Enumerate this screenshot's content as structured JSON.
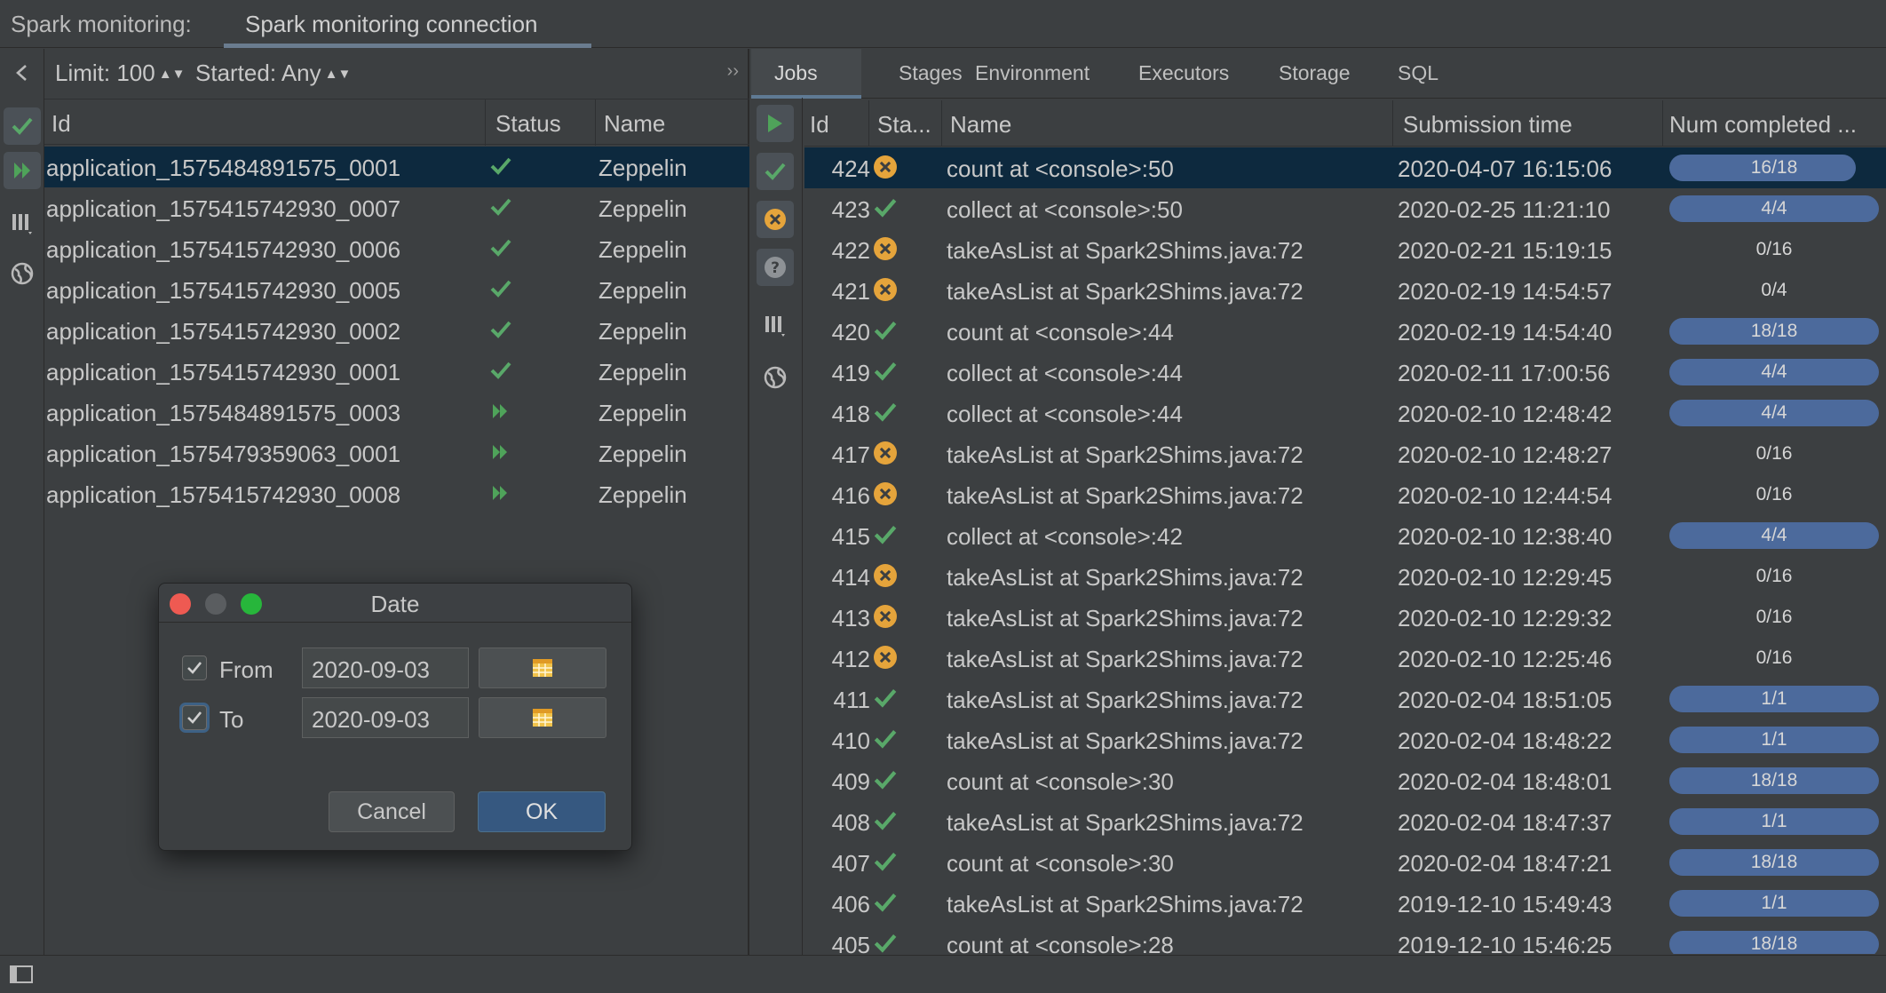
{
  "titlebar": {
    "label": "Spark monitoring:",
    "tab": "Spark monitoring connection"
  },
  "app_toolbar": {
    "limit": "Limit: 100",
    "started": "Started: Any",
    "expand": "››"
  },
  "app_table": {
    "headers": {
      "id": "Id",
      "status": "Status",
      "name": "Name"
    },
    "rows": [
      {
        "id": "application_1575484891575_0001",
        "status": "completed",
        "name": "Zeppelin"
      },
      {
        "id": "application_1575415742930_0007",
        "status": "completed",
        "name": "Zeppelin"
      },
      {
        "id": "application_1575415742930_0006",
        "status": "completed",
        "name": "Zeppelin"
      },
      {
        "id": "application_1575415742930_0005",
        "status": "completed",
        "name": "Zeppelin"
      },
      {
        "id": "application_1575415742930_0002",
        "status": "completed",
        "name": "Zeppelin"
      },
      {
        "id": "application_1575415742930_0001",
        "status": "completed",
        "name": "Zeppelin"
      },
      {
        "id": "application_1575484891575_0003",
        "status": "running",
        "name": "Zeppelin"
      },
      {
        "id": "application_1575479359063_0001",
        "status": "running",
        "name": "Zeppelin"
      },
      {
        "id": "application_1575415742930_0008",
        "status": "running",
        "name": "Zeppelin"
      }
    ]
  },
  "tabs": [
    "Jobs",
    "Stages",
    "Environment",
    "Executors",
    "Storage",
    "SQL"
  ],
  "jobs_table": {
    "headers": {
      "id": "Id",
      "status": "Sta...",
      "name": "Name",
      "time": "Submission time",
      "num": "Num completed ..."
    },
    "rows": [
      {
        "id": "424",
        "status": "failed",
        "name": "count at <console>:50",
        "time": "2020-04-07 16:15:06",
        "progress": "16/18",
        "fraction": 0.89
      },
      {
        "id": "423",
        "status": "succeeded",
        "name": "collect at <console>:50",
        "time": "2020-02-25 11:21:10",
        "progress": "4/4",
        "fraction": 1.0
      },
      {
        "id": "422",
        "status": "failed",
        "name": "takeAsList at Spark2Shims.java:72",
        "time": "2020-02-21 15:19:15",
        "progress": "0/16",
        "fraction": 0
      },
      {
        "id": "421",
        "status": "failed",
        "name": "takeAsList at Spark2Shims.java:72",
        "time": "2020-02-19 14:54:57",
        "progress": "0/4",
        "fraction": 0
      },
      {
        "id": "420",
        "status": "succeeded",
        "name": "count at <console>:44",
        "time": "2020-02-19 14:54:40",
        "progress": "18/18",
        "fraction": 1.0
      },
      {
        "id": "419",
        "status": "succeeded",
        "name": "collect at <console>:44",
        "time": "2020-02-11 17:00:56",
        "progress": "4/4",
        "fraction": 1.0
      },
      {
        "id": "418",
        "status": "succeeded",
        "name": "collect at <console>:44",
        "time": "2020-02-10 12:48:42",
        "progress": "4/4",
        "fraction": 1.0
      },
      {
        "id": "417",
        "status": "failed",
        "name": "takeAsList at Spark2Shims.java:72",
        "time": "2020-02-10 12:48:27",
        "progress": "0/16",
        "fraction": 0
      },
      {
        "id": "416",
        "status": "failed",
        "name": "takeAsList at Spark2Shims.java:72",
        "time": "2020-02-10 12:44:54",
        "progress": "0/16",
        "fraction": 0
      },
      {
        "id": "415",
        "status": "succeeded",
        "name": "collect at <console>:42",
        "time": "2020-02-10 12:38:40",
        "progress": "4/4",
        "fraction": 1.0
      },
      {
        "id": "414",
        "status": "failed",
        "name": "takeAsList at Spark2Shims.java:72",
        "time": "2020-02-10 12:29:45",
        "progress": "0/16",
        "fraction": 0
      },
      {
        "id": "413",
        "status": "failed",
        "name": "takeAsList at Spark2Shims.java:72",
        "time": "2020-02-10 12:29:32",
        "progress": "0/16",
        "fraction": 0
      },
      {
        "id": "412",
        "status": "failed",
        "name": "takeAsList at Spark2Shims.java:72",
        "time": "2020-02-10 12:25:46",
        "progress": "0/16",
        "fraction": 0
      },
      {
        "id": "411",
        "status": "succeeded",
        "name": "takeAsList at Spark2Shims.java:72",
        "time": "2020-02-04 18:51:05",
        "progress": "1/1",
        "fraction": 1.0
      },
      {
        "id": "410",
        "status": "succeeded",
        "name": "takeAsList at Spark2Shims.java:72",
        "time": "2020-02-04 18:48:22",
        "progress": "1/1",
        "fraction": 1.0
      },
      {
        "id": "409",
        "status": "succeeded",
        "name": "count at <console>:30",
        "time": "2020-02-04 18:48:01",
        "progress": "18/18",
        "fraction": 1.0
      },
      {
        "id": "408",
        "status": "succeeded",
        "name": "takeAsList at Spark2Shims.java:72",
        "time": "2020-02-04 18:47:37",
        "progress": "1/1",
        "fraction": 1.0
      },
      {
        "id": "407",
        "status": "succeeded",
        "name": "count at <console>:30",
        "time": "2020-02-04 18:47:21",
        "progress": "18/18",
        "fraction": 1.0
      },
      {
        "id": "406",
        "status": "succeeded",
        "name": "takeAsList at Spark2Shims.java:72",
        "time": "2019-12-10 15:49:43",
        "progress": "1/1",
        "fraction": 1.0
      },
      {
        "id": "405",
        "status": "succeeded",
        "name": "count at <console>:28",
        "time": "2019-12-10 15:46:25",
        "progress": "18/18",
        "fraction": 1.0
      }
    ]
  },
  "dialog": {
    "title": "Date",
    "from_label": "From",
    "from_value": "2020-09-03",
    "to_label": "To",
    "to_value": "2020-09-03",
    "cancel": "Cancel",
    "ok": "OK"
  },
  "colors": {
    "success": "#59a869",
    "failed": "#e5a43b",
    "running": "#4fa35a",
    "accent": "#365880",
    "selected_row": "#0d293e",
    "progress": "#4c6a9c"
  }
}
